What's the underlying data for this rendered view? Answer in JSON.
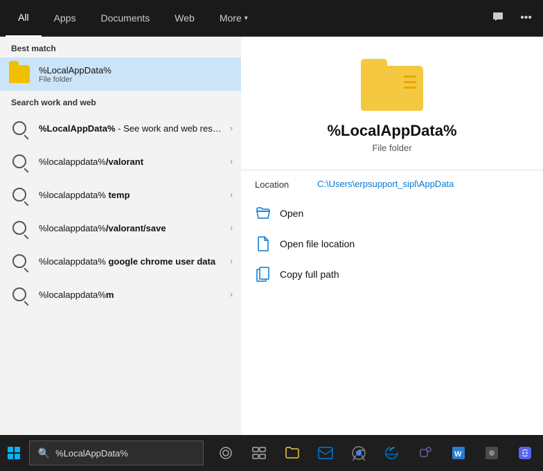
{
  "nav": {
    "tabs": [
      {
        "label": "All",
        "active": true
      },
      {
        "label": "Apps",
        "active": false
      },
      {
        "label": "Documents",
        "active": false
      },
      {
        "label": "Web",
        "active": false
      },
      {
        "label": "More",
        "active": false
      }
    ],
    "more_arrow": "▾"
  },
  "left": {
    "best_match_label": "Best match",
    "best_match": {
      "name": "%LocalAppData%",
      "subtitle": "File folder"
    },
    "search_section_label": "Search work and web",
    "search_results": [
      {
        "title_plain": "%LocalAppData%",
        "title_suffix": " - See work and web results",
        "subtitle": ""
      },
      {
        "title_plain": "%localappdata%",
        "title_bold": "/valorant",
        "subtitle": ""
      },
      {
        "title_plain": "%localappdata%",
        "title_suffix": " temp",
        "title_bold_suffix": "temp",
        "subtitle": ""
      },
      {
        "title_plain": "%localappdata%",
        "title_bold": "/valorant/save",
        "subtitle": ""
      },
      {
        "title_plain": "%localappdata%",
        "title_suffix": " google chrome user data",
        "title_bold_suffix": "google chrome user data",
        "subtitle": ""
      },
      {
        "title_plain": "%localappdata%",
        "title_bold": "m",
        "subtitle": ""
      }
    ]
  },
  "right": {
    "app_name": "%LocalAppData%",
    "app_type": "File folder",
    "location_label": "Location",
    "location_path": "C:\\Users\\erpsupport_sipl\\AppData",
    "actions": [
      {
        "label": "Open",
        "icon": "open-folder-icon"
      },
      {
        "label": "Open file location",
        "icon": "file-location-icon"
      },
      {
        "label": "Copy full path",
        "icon": "copy-path-icon"
      }
    ]
  },
  "taskbar": {
    "search_text": "%LocalAppData%",
    "search_placeholder": "%LocalAppData%"
  }
}
